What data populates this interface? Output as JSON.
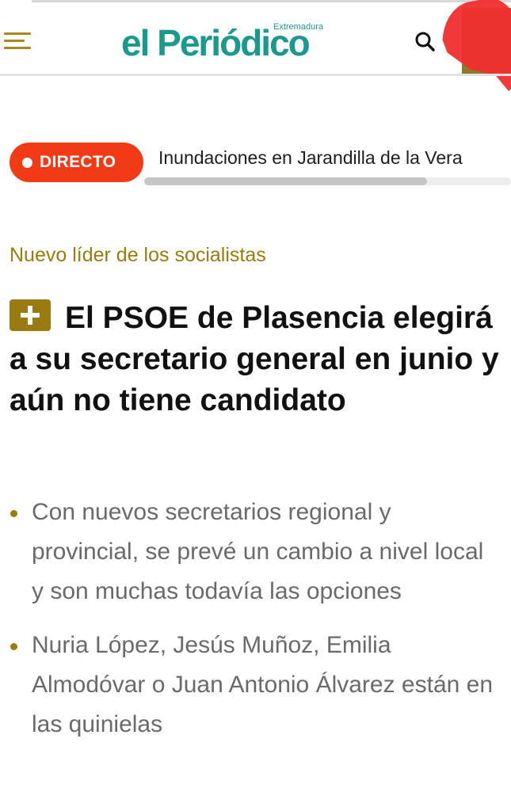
{
  "header": {
    "logo_main": "el Periódico",
    "logo_sub": "Extremadura",
    "menu_icon": "hamburger-menu-icon",
    "search_icon": "search-icon",
    "user_icon": "user-avatar-icon",
    "brand_color": "#1a9a8c",
    "accent_color": "#9a7c0c"
  },
  "live": {
    "badge_label": "DIRECTO",
    "badge_color": "#f23b16",
    "ticker_text": "Inundaciones en Jarandilla de la Vera",
    "scroll_progress": 0.77
  },
  "article": {
    "kicker": "Nuevo líder de los socialistas",
    "premium_icon": "plus-icon",
    "headline": "El PSOE de Plasencia elegirá a su secretario general en junio y aún no tiene candidato",
    "summary": [
      "Con nuevos secretarios regional y provincial, se prevé un cambio a nivel local y son muchas todavía las opciones",
      "Nuria López, Jesús Muñoz, Emilia Almodóvar o Juan Antonio Álvarez están en las quinielas"
    ]
  }
}
